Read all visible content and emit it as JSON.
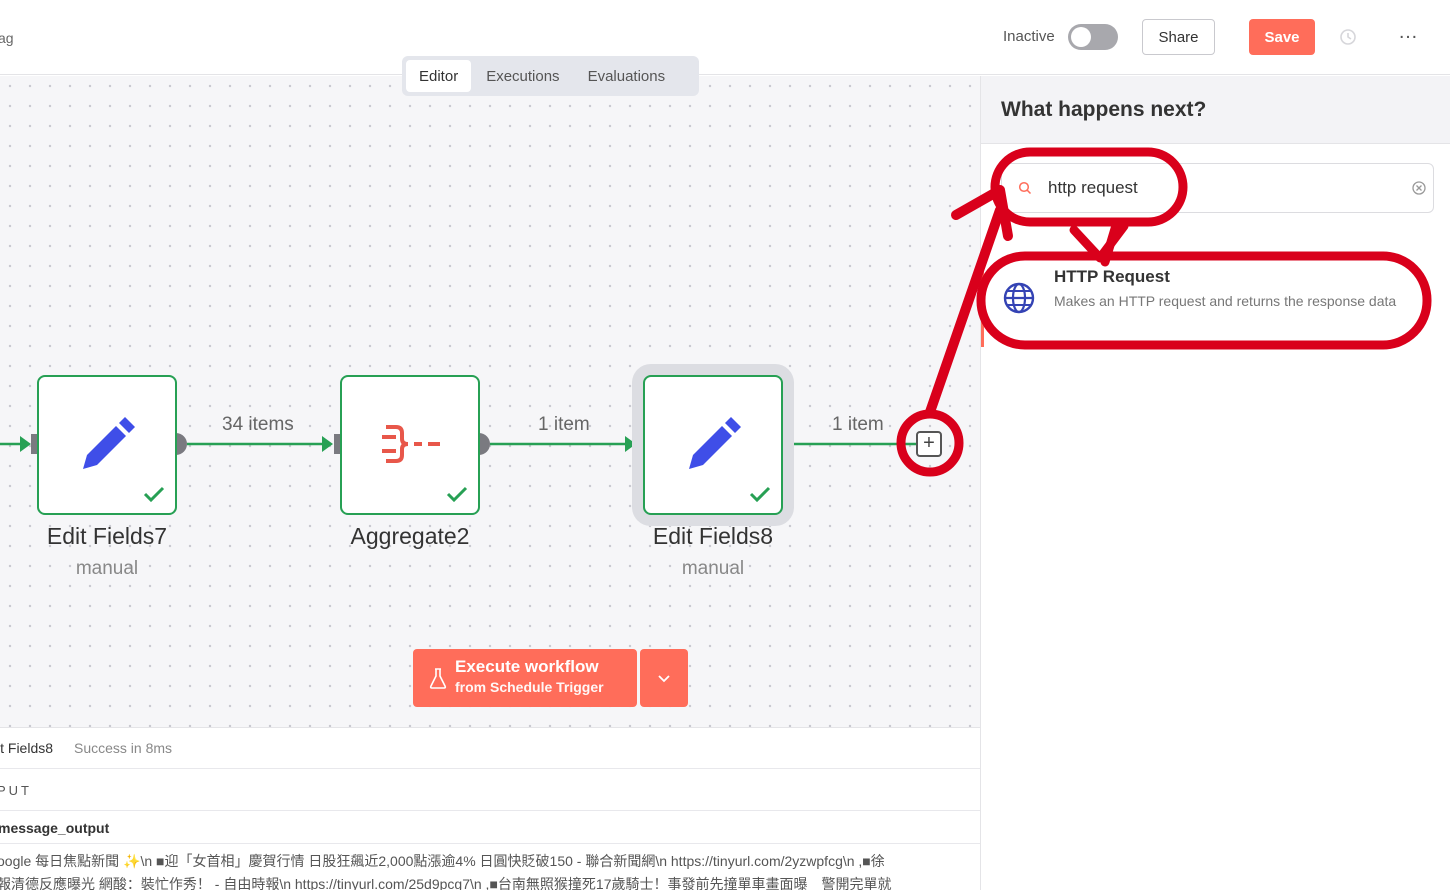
{
  "header": {
    "breadcrumb_fragment": "ag",
    "active_toggle_label": "Inactive",
    "share_label": "Share",
    "save_label": "Save",
    "more_label": "…"
  },
  "tabs": [
    {
      "label": "Editor",
      "active": true
    },
    {
      "label": "Executions",
      "active": false
    },
    {
      "label": "Evaluations",
      "active": false
    }
  ],
  "nodes": [
    {
      "title": "Edit Fields7",
      "subtitle": "manual",
      "icon": "pencil-icon",
      "status": "success"
    },
    {
      "title": "Aggregate2",
      "subtitle": "",
      "icon": "aggregate-icon",
      "status": "success"
    },
    {
      "title": "Edit Fields8",
      "subtitle": "manual",
      "icon": "pencil-icon",
      "status": "success",
      "selected": true
    }
  ],
  "connections": [
    {
      "label": "34 items"
    },
    {
      "label": "1 item"
    },
    {
      "label": "1 item"
    }
  ],
  "execute": {
    "main_label": "Execute workflow",
    "sub_label": "from Schedule Trigger"
  },
  "log": {
    "node_name": "it Fields8",
    "status": "Success in 8ms",
    "section": "PUT",
    "field_name": "message_output",
    "lines": [
      "oogle 每日焦點新聞 ✨\\n ■迎「女首相」慶賀行情 日股狂飆近2,000點漲逾4% 日圓快貶破150 - 聯合新聞網\\n https://tinyurl.com/2yzwpfcg\\n ,■徐",
      "報清德反應曝光 網酸：裝忙作秀！ - 自由時報\\n https://tinyurl.com/25d9pcg7\\n ,■台南無照猴撞死17歲騎士！事發前先撞單車畫面曝　警開完單就"
    ]
  },
  "panel": {
    "title": "What happens next?",
    "search_value": "http request",
    "result": {
      "title": "HTTP Request",
      "description": "Makes an HTTP request and returns the response data",
      "icon": "globe-icon"
    }
  },
  "colors": {
    "accent": "#ff6d5a",
    "success": "#27a054",
    "pencil": "#3f4ee8",
    "annotation": "#d9001b"
  }
}
